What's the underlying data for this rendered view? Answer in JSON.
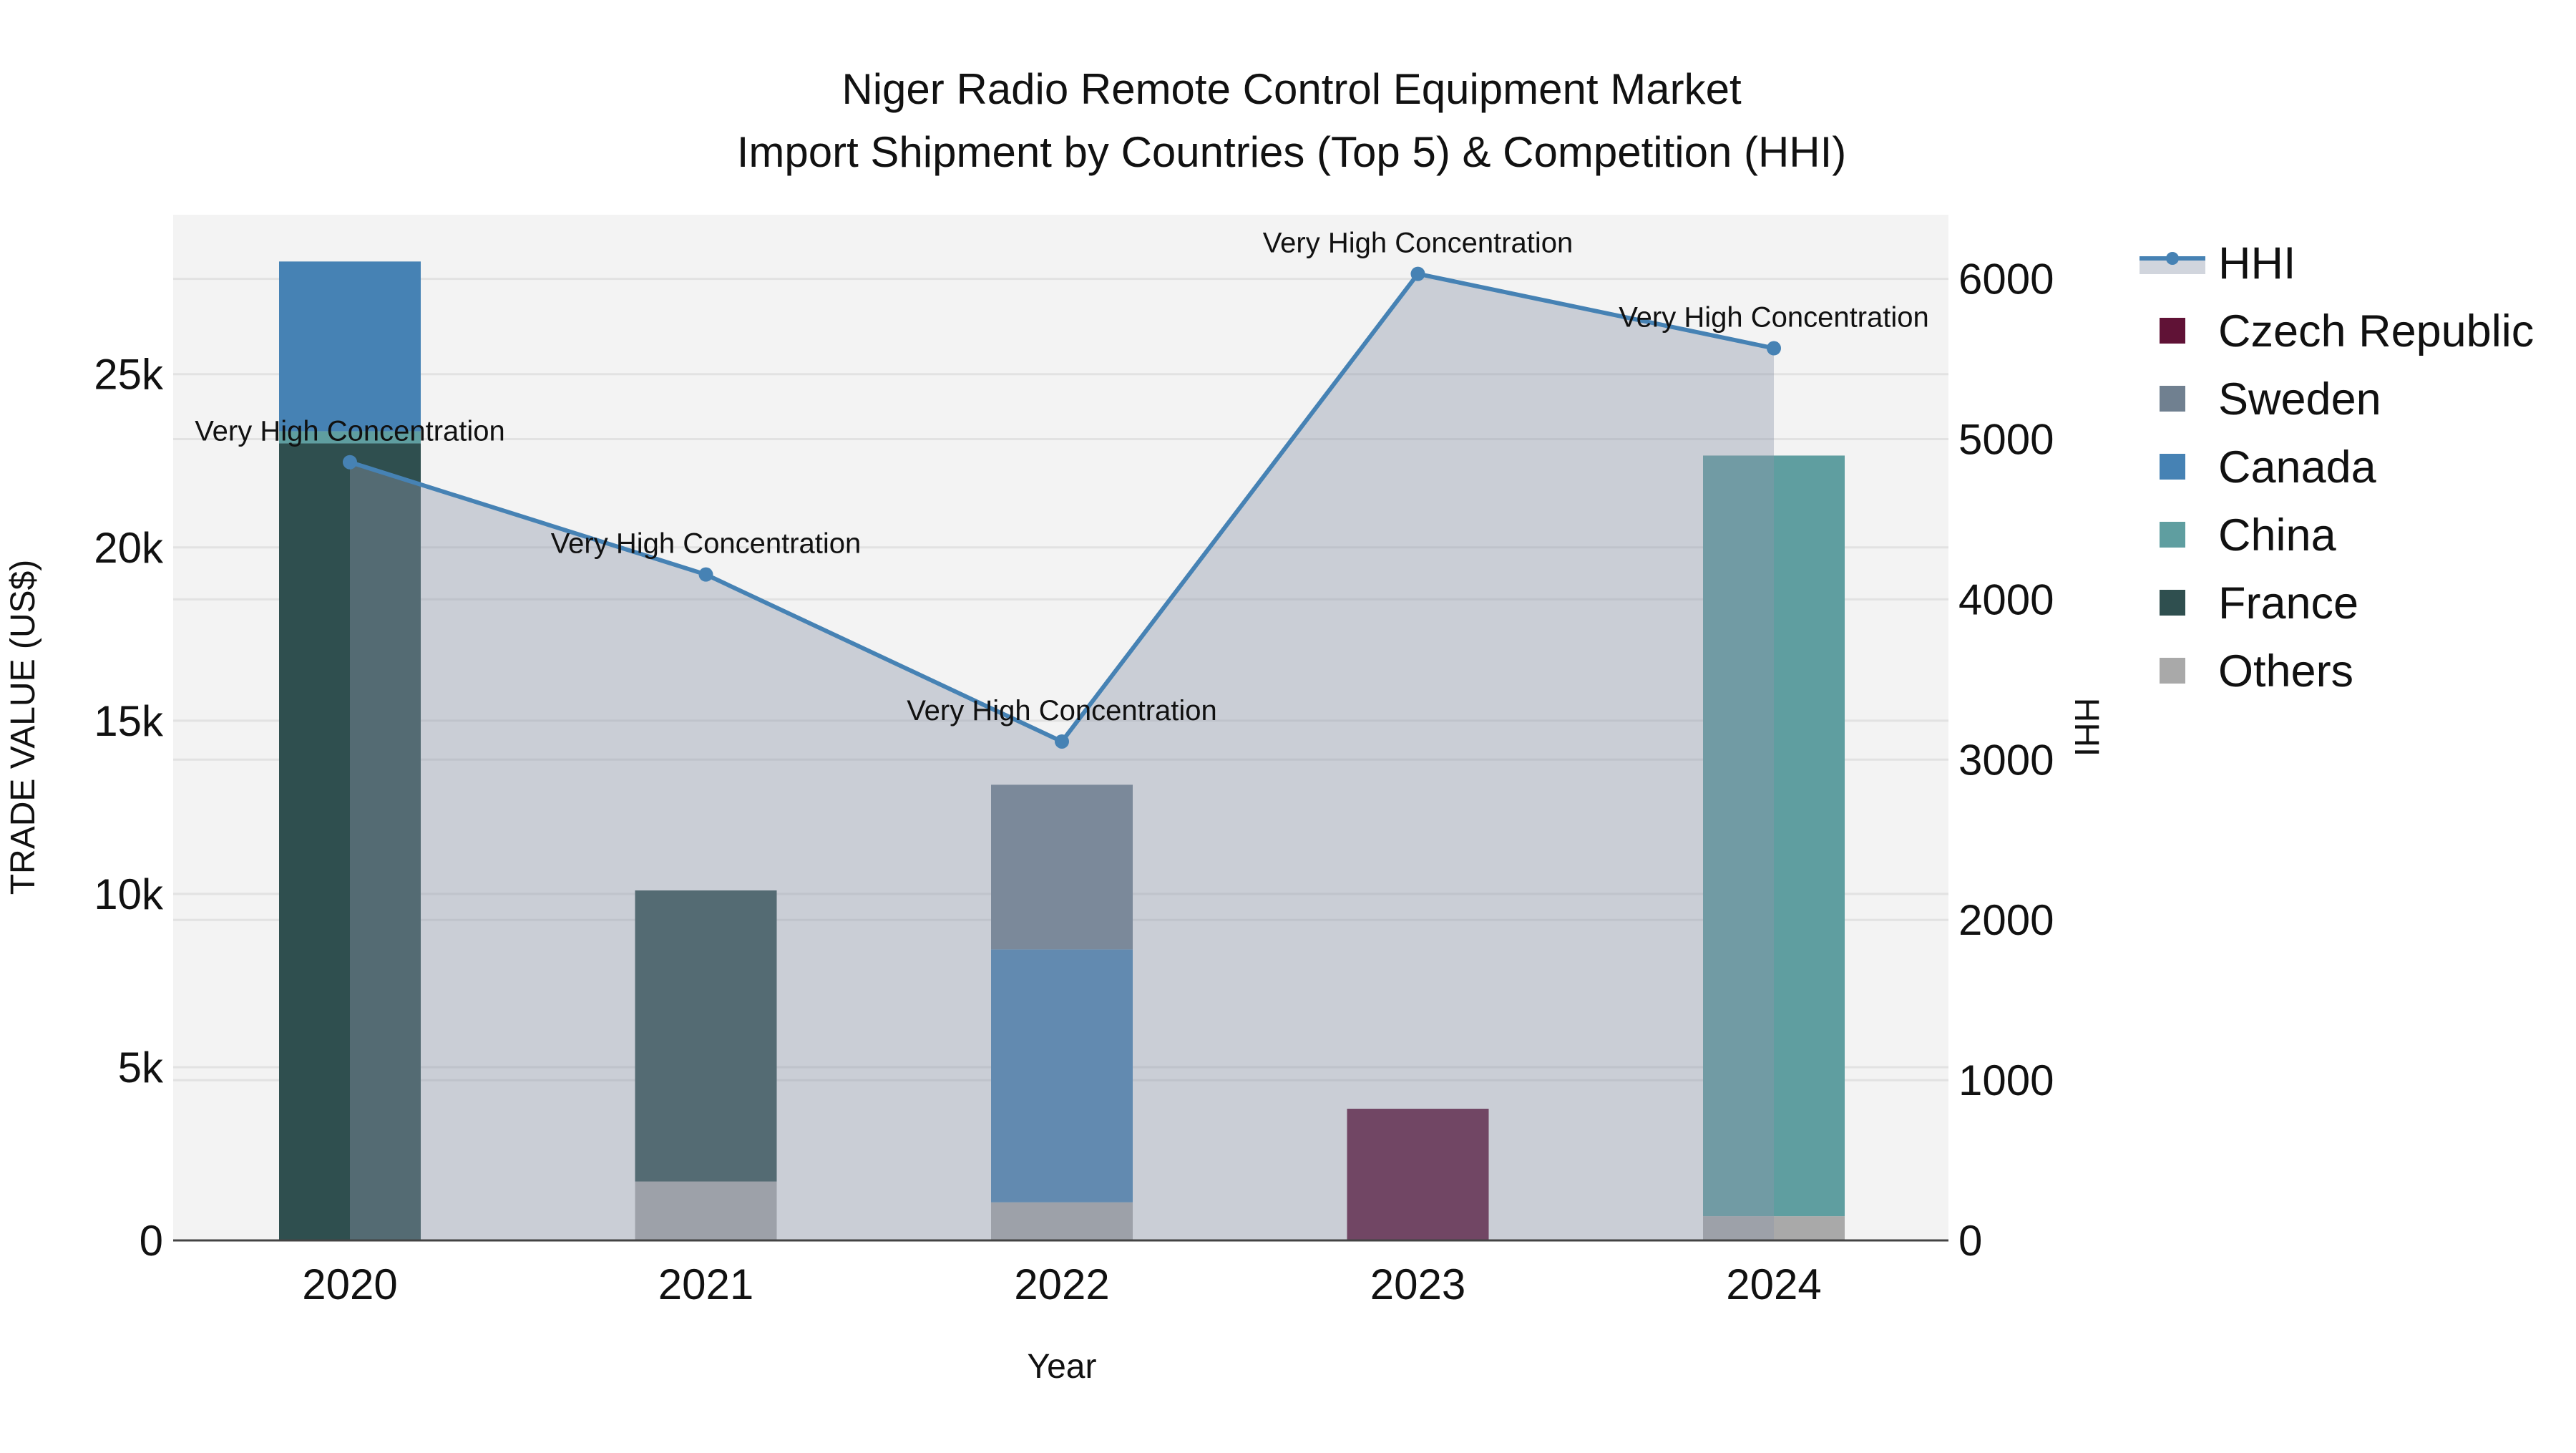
{
  "chart_data": {
    "type": "bar",
    "title_line1": "Niger Radio Remote Control Equipment Market",
    "title_line2": "Import Shipment by Countries (Top 5) & Competition (HHI)",
    "xlabel": "Year",
    "ylabel": "TRADE VALUE (US$)",
    "y2label": "HHI",
    "categories": [
      "2020",
      "2021",
      "2022",
      "2023",
      "2024"
    ],
    "ylim": [
      0,
      29600
    ],
    "y2lim": [
      0,
      6400
    ],
    "yticks": [
      0,
      5000,
      10000,
      15000,
      20000,
      25000
    ],
    "ytick_labels": [
      "0",
      "5k",
      "10k",
      "15k",
      "20k",
      "25k"
    ],
    "y2ticks": [
      0,
      1000,
      2000,
      3000,
      4000,
      5000,
      6000
    ],
    "y2tick_labels": [
      "0",
      "1000",
      "2000",
      "3000",
      "4000",
      "5000",
      "6000"
    ],
    "barmode": "stack",
    "series": [
      {
        "name": "Others",
        "color": "#a9a9a9",
        "values": [
          0,
          1700,
          1100,
          0,
          700
        ]
      },
      {
        "name": "France",
        "color": "#2f4f4f",
        "values": [
          23000,
          8400,
          0,
          0,
          0
        ]
      },
      {
        "name": "China",
        "color": "#5f9ea0",
        "values": [
          350,
          0,
          0,
          0,
          21950
        ]
      },
      {
        "name": "Canada",
        "color": "#4682b4",
        "values": [
          4900,
          0,
          7300,
          0,
          0
        ]
      },
      {
        "name": "Sweden",
        "color": "#708090",
        "values": [
          0,
          0,
          4750,
          0,
          0
        ]
      },
      {
        "name": "Czech Republic",
        "color": "#601236",
        "values": [
          0,
          0,
          0,
          3800,
          0
        ]
      }
    ],
    "hhi": {
      "name": "HHI",
      "color": "#4682b4",
      "values": [
        4856,
        4155,
        3113,
        6031,
        5567
      ],
      "annotations": [
        "Very High Concentration",
        "Very High Concentration",
        "Very High Concentration",
        "Very High Concentration",
        "Very High Concentration"
      ]
    },
    "legend": [
      "HHI",
      "Czech Republic",
      "Sweden",
      "Canada",
      "China",
      "France",
      "Others"
    ],
    "legend_position": "right",
    "grid": true
  }
}
